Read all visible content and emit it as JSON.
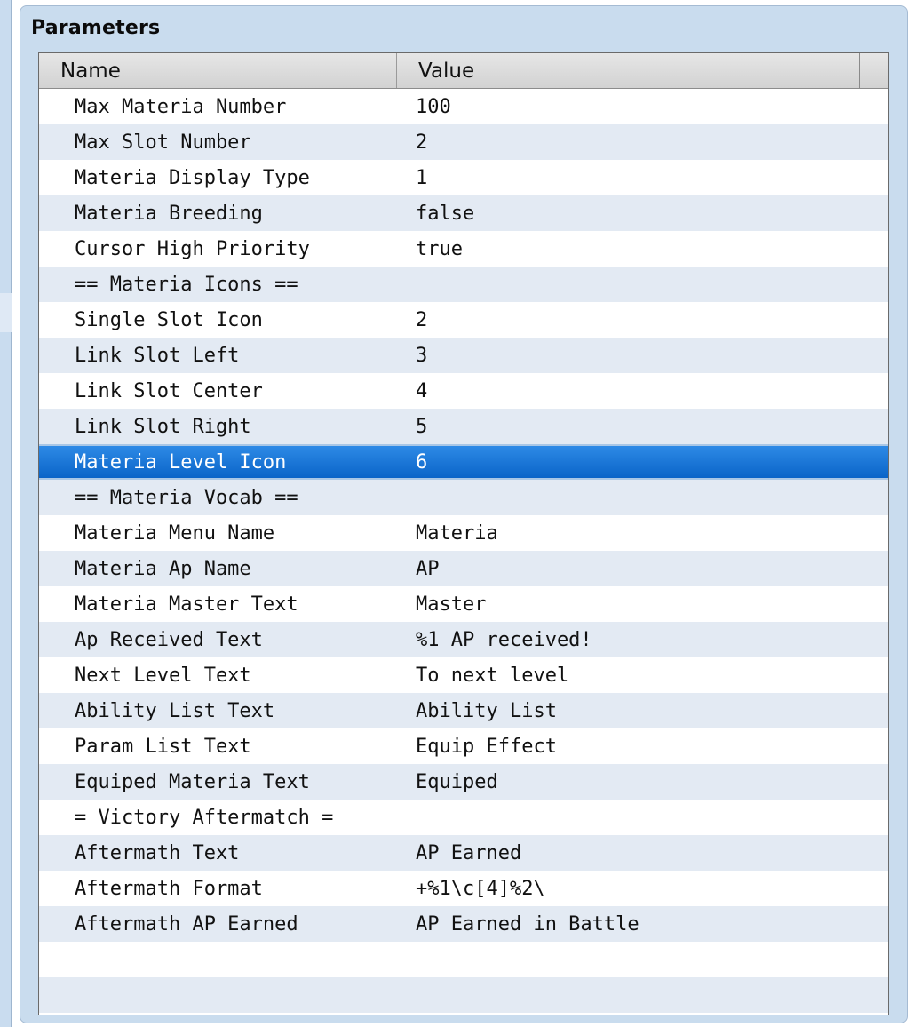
{
  "panel": {
    "title": "Parameters"
  },
  "table": {
    "columns": [
      "Name",
      "Value"
    ],
    "selected_index": 10,
    "rows": [
      {
        "name": "Max Materia Number",
        "value": "100"
      },
      {
        "name": "Max Slot Number",
        "value": "2"
      },
      {
        "name": "Materia Display Type",
        "value": "1"
      },
      {
        "name": "Materia Breeding",
        "value": "false"
      },
      {
        "name": "Cursor High Priority",
        "value": "true"
      },
      {
        "name": "== Materia Icons ==",
        "value": ""
      },
      {
        "name": "Single Slot Icon",
        "value": "2"
      },
      {
        "name": "Link Slot Left",
        "value": "3"
      },
      {
        "name": "Link Slot Center",
        "value": "4"
      },
      {
        "name": "Link Slot Right",
        "value": "5"
      },
      {
        "name": "Materia Level Icon",
        "value": "6"
      },
      {
        "name": "== Materia Vocab ==",
        "value": ""
      },
      {
        "name": "Materia Menu Name",
        "value": "Materia"
      },
      {
        "name": "Materia Ap Name",
        "value": "AP"
      },
      {
        "name": "Materia Master Text",
        "value": "Master"
      },
      {
        "name": "Ap Received Text",
        "value": "%1 AP received!"
      },
      {
        "name": "Next Level Text",
        "value": "To next level"
      },
      {
        "name": "Ability List Text",
        "value": "Ability List"
      },
      {
        "name": "Param List Text",
        "value": "Equip Effect"
      },
      {
        "name": "Equiped Materia Text",
        "value": "Equiped"
      },
      {
        "name": "= Victory Aftermatch =",
        "value": ""
      },
      {
        "name": "Aftermath Text",
        "value": "AP Earned"
      },
      {
        "name": "Aftermath Format",
        "value": "+%1\\c[4]%2\\"
      },
      {
        "name": "Aftermath AP Earned",
        "value": "AP Earned in Battle"
      },
      {
        "name": "",
        "value": ""
      },
      {
        "name": "",
        "value": ""
      }
    ]
  },
  "colors": {
    "panel_bg": "#c9dcee",
    "row_alt": "#e3eaf3",
    "selection": "#0a64c8"
  }
}
